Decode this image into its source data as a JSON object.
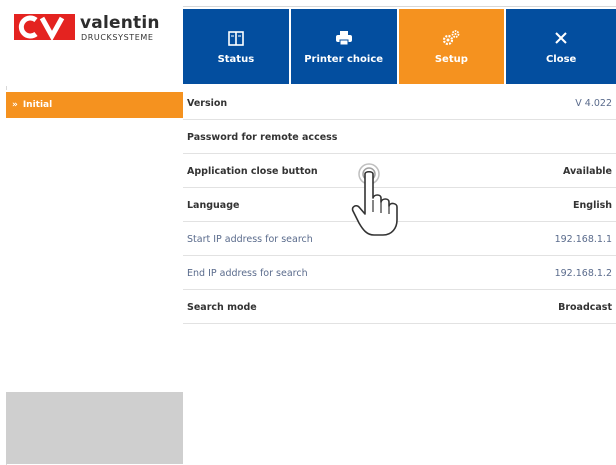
{
  "brand": {
    "name": "valentin",
    "subtitle": "DRUCKSYSTEME",
    "accent": "#f5921f",
    "nav_color": "#034e9f",
    "logo_color": "#e42320"
  },
  "nav": [
    {
      "label": "Status",
      "icon": "status-icon",
      "active": false
    },
    {
      "label": "Printer choice",
      "icon": "printer-icon",
      "active": false
    },
    {
      "label": "Setup",
      "icon": "gears-icon",
      "active": true
    },
    {
      "label": "Close",
      "icon": "close-icon",
      "active": false
    }
  ],
  "sidebar": {
    "items": [
      {
        "label": "Initial",
        "selected": true
      }
    ]
  },
  "settings": [
    {
      "label": "Version",
      "value": "V 4.022"
    },
    {
      "label": "Password for remote access",
      "value": ""
    },
    {
      "label": "Application close button",
      "value": "Available"
    },
    {
      "label": "Language",
      "value": "English"
    },
    {
      "label": "Start IP address for search",
      "value": "192.168.1.1"
    },
    {
      "label": "End IP address for search",
      "value": "192.168.1.2"
    },
    {
      "label": "Search mode",
      "value": "Broadcast"
    }
  ]
}
